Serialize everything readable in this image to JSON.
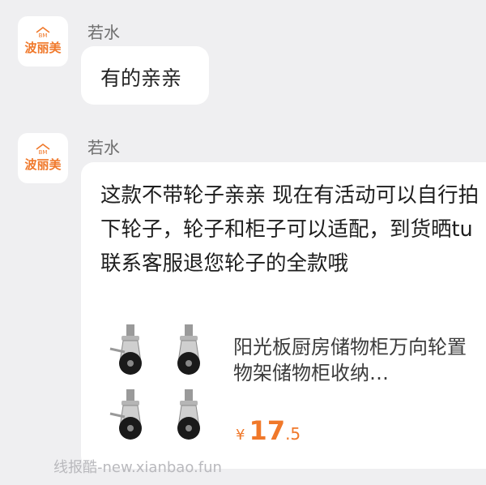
{
  "messages": [
    {
      "sender": "若水",
      "avatar": {
        "badge": "BM",
        "brand": "波丽美"
      },
      "text": "有的亲亲"
    },
    {
      "sender": "若水",
      "avatar": {
        "badge": "BM",
        "brand": "波丽美"
      },
      "text": "这款不带轮子亲亲 现在有活动可以自行拍下轮子，轮子和柜子可以适配，到货晒tu联系客服退您轮子的全款哦",
      "product_card": {
        "title": "阳光板厨房储物柜万向轮置物架储物柜收纳…",
        "currency": "¥",
        "price_int": "17",
        "price_dec": ".5",
        "image": "caster-wheels-icon"
      }
    }
  ],
  "watermark": "线报酷-new.xianbao.fun",
  "colors": {
    "background": "#efeff1",
    "brand": "#f0782a",
    "bubble": "#ffffff"
  }
}
